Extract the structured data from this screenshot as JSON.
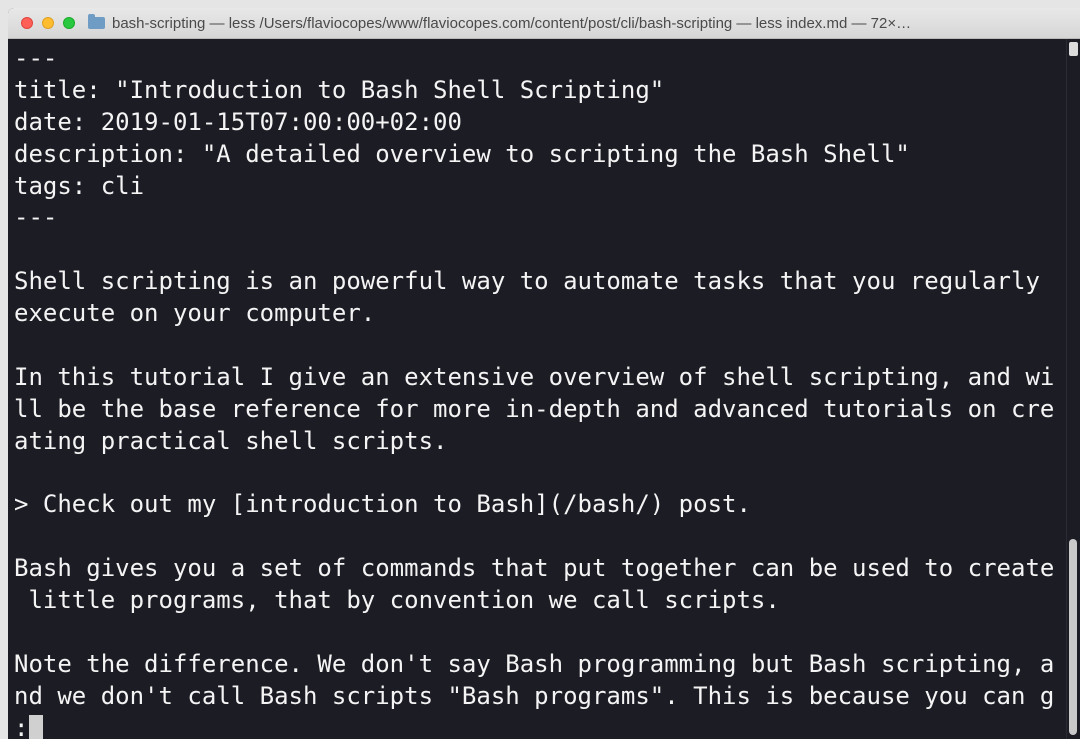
{
  "window": {
    "title": "bash-scripting — less   /Users/flaviocopes/www/flaviocopes.com/content/post/cli/bash-scripting — less index.md — 72×…"
  },
  "terminal": {
    "lines": [
      "---",
      "title: \"Introduction to Bash Shell Scripting\"",
      "date: 2019-01-15T07:00:00+02:00",
      "description: \"A detailed overview to scripting the Bash Shell\"",
      "tags: cli",
      "---",
      "",
      "Shell scripting is an powerful way to automate tasks that you regularly",
      "execute on your computer.",
      "",
      "In this tutorial I give an extensive overview of shell scripting, and wi",
      "ll be the base reference for more in-depth and advanced tutorials on cre",
      "ating practical shell scripts.",
      "",
      "> Check out my [introduction to Bash](/bash/) post.",
      "",
      "Bash gives you a set of commands that put together can be used to create",
      " little programs, that by convention we call scripts.",
      "",
      "Note the difference. We don't say Bash programming but Bash scripting, a",
      "nd we don't call Bash scripts \"Bash programs\". This is because you can g"
    ],
    "prompt": ":"
  },
  "icons": {
    "folder": "folder-icon"
  },
  "colors": {
    "background": "#1c1c25",
    "text": "#f4f4f4"
  }
}
